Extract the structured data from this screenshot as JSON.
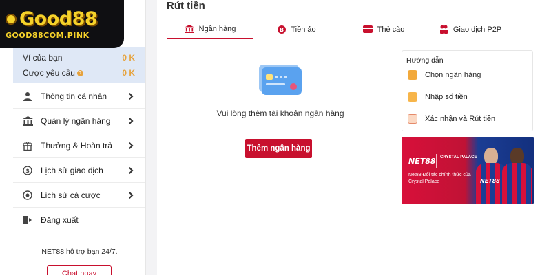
{
  "brand": {
    "logo_text": "Good88",
    "logo_url": "GOOD88COM.PINK"
  },
  "wallet": {
    "balance_label": "Ví của bạn",
    "balance_value": "0 K",
    "bet_label": "Cược yêu cầu",
    "bet_value": "0 K"
  },
  "menu": [
    {
      "label": "Thông tin cá nhân",
      "icon": "user-icon"
    },
    {
      "label": "Quản lý ngân hàng",
      "icon": "bank-icon"
    },
    {
      "label": "Thưởng & Hoàn trả",
      "icon": "gift-icon"
    },
    {
      "label": "Lịch sử giao dịch",
      "icon": "transaction-history-icon"
    },
    {
      "label": "Lịch sử cá cược",
      "icon": "bet-history-icon"
    },
    {
      "label": "Đăng xuất",
      "icon": "logout-icon"
    }
  ],
  "support": {
    "text": "NET88 hỗ trợ bạn 24/7.",
    "chat_label": "Chat ngay"
  },
  "page": {
    "title": "Rút tiền"
  },
  "tabs": [
    {
      "label": "Ngân hàng",
      "icon": "bank-icon",
      "active": true
    },
    {
      "label": "Tiền ảo",
      "icon": "crypto-coin-icon",
      "active": false
    },
    {
      "label": "Thẻ cào",
      "icon": "scratch-card-icon",
      "active": false
    },
    {
      "label": "Giao dịch P2P",
      "icon": "p2p-icon",
      "active": false
    }
  ],
  "empty_state": {
    "message": "Vui lòng thêm tài khoản ngân hàng",
    "button_label": "Thêm ngân hàng"
  },
  "guide": {
    "title": "Hướng dẫn",
    "steps": [
      "Chọn ngân hàng",
      "Nhập số tiền",
      "Xác nhận và Rút tiền"
    ]
  },
  "banner": {
    "logo": "NET88",
    "partner": "CRYSTAL PALACE",
    "tagline": "Net88 Đối tác chính thức của Crystal Palace",
    "jersey_text": "NET88"
  },
  "colors": {
    "accent": "#c8102e",
    "gold": "#e6a23c",
    "wallet_bg": "#dfe8f6"
  }
}
